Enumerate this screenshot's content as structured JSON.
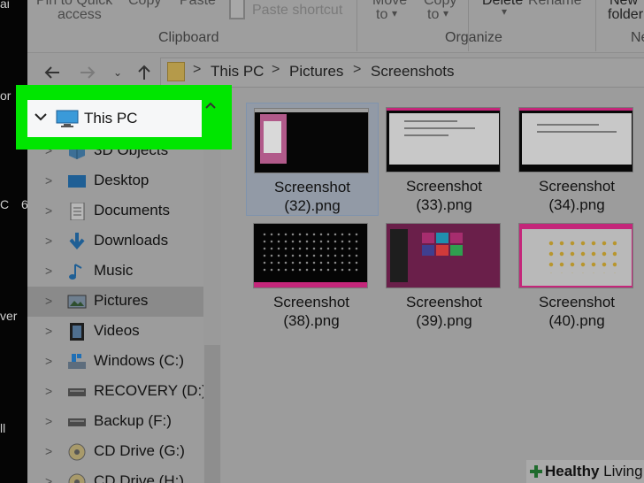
{
  "desktop_strip": {
    "fragments": [
      "ai",
      "or",
      "C",
      "6",
      "ver",
      "ll"
    ]
  },
  "ribbon": {
    "pin_label_top": "Pin to Quick",
    "pin_label_bottom": "access",
    "copy_label": "Copy",
    "paste_label": "Paste",
    "paste_shortcut_label": "Paste shortcut",
    "move_label_top": "Move",
    "move_label_bottom": "to",
    "copy_to_label_top": "Copy",
    "copy_to_label_bottom": "to",
    "delete_label": "Delete",
    "rename_label": "Rename",
    "new_folder_top": "New",
    "new_folder_bottom": "folder",
    "group_clipboard": "Clipboard",
    "group_organize": "Organize",
    "group_new": "Ne"
  },
  "address": {
    "crumbs": [
      "This PC",
      "Pictures",
      "Screenshots"
    ],
    "separator": ">"
  },
  "nav_pane": {
    "highlighted_item": "This PC",
    "items": [
      {
        "label": "3D Objects",
        "icon": "3d-objects-icon"
      },
      {
        "label": "Desktop",
        "icon": "desktop-icon"
      },
      {
        "label": "Documents",
        "icon": "documents-icon"
      },
      {
        "label": "Downloads",
        "icon": "downloads-icon"
      },
      {
        "label": "Music",
        "icon": "music-icon"
      },
      {
        "label": "Pictures",
        "icon": "pictures-icon",
        "selected": true
      },
      {
        "label": "Videos",
        "icon": "videos-icon"
      },
      {
        "label": "Windows (C:)",
        "icon": "windows-drive-icon"
      },
      {
        "label": "RECOVERY (D:)",
        "icon": "drive-icon"
      },
      {
        "label": "Backup (F:)",
        "icon": "drive-icon"
      },
      {
        "label": "CD Drive (G:)",
        "icon": "cd-drive-icon"
      },
      {
        "label": "CD Drive (H:)",
        "icon": "cd-drive-icon"
      }
    ]
  },
  "files": [
    {
      "line1": "Screenshot",
      "line2": "(32).png",
      "selected": true
    },
    {
      "line1": "Screenshot",
      "line2": "(33).png"
    },
    {
      "line1": "Screenshot",
      "line2": "(34).png"
    },
    {
      "line1": "Screenshot",
      "line2": "(38).png"
    },
    {
      "line1": "Screenshot",
      "line2": "(39).png"
    },
    {
      "line1": "Screenshot",
      "line2": "(40).png"
    }
  ],
  "colors": {
    "highlight": "#00e600",
    "dim_overlay": "#9c9c9c"
  },
  "watermark": {
    "bold": "Healthy",
    "normal": " Living"
  }
}
